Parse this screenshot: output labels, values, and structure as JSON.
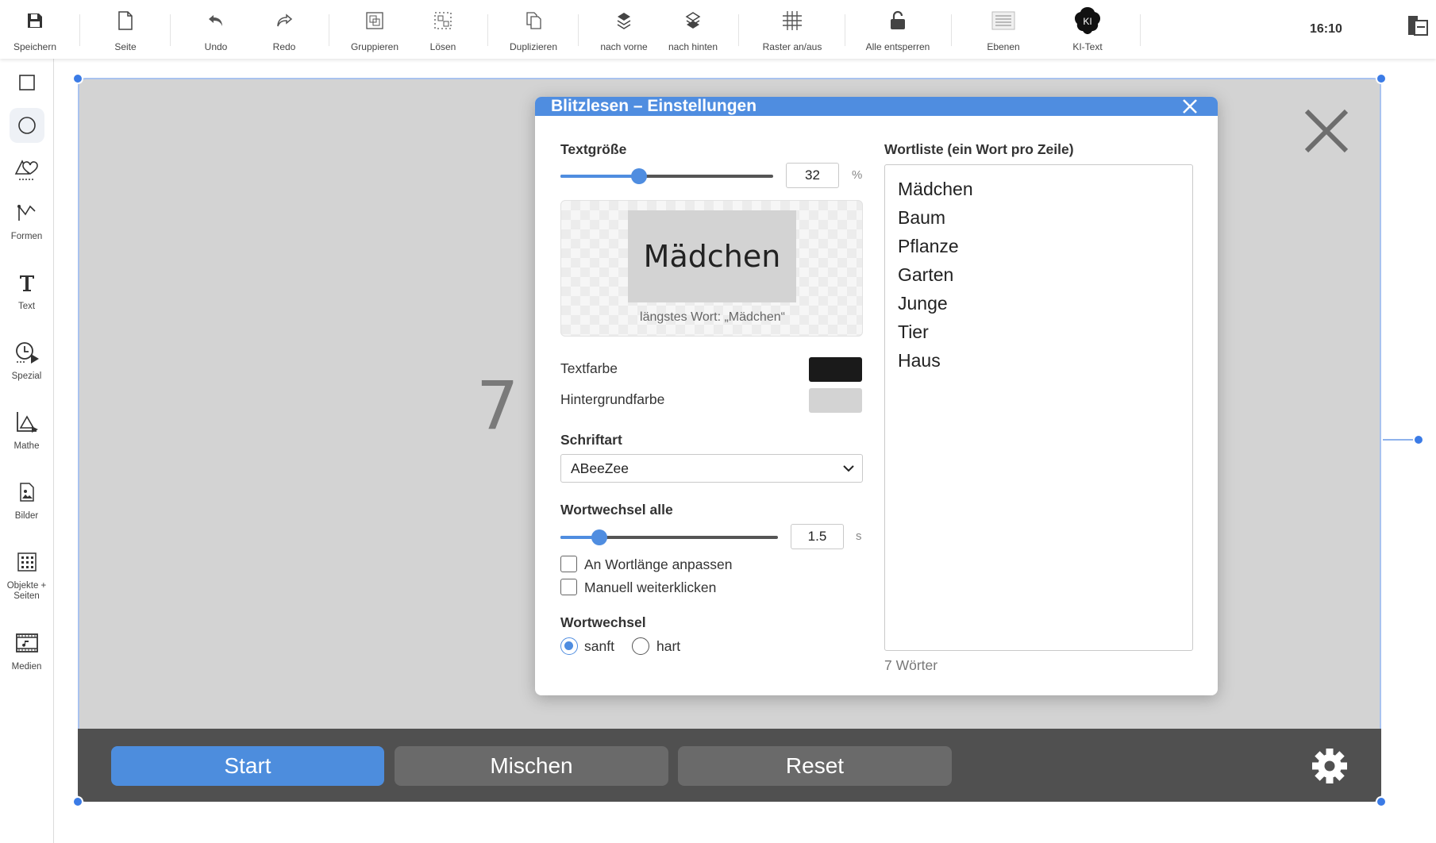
{
  "toolbar": {
    "items": [
      {
        "label": "Speichern",
        "icon": "floppy-disk-icon"
      },
      {
        "label": "Seite",
        "icon": "page-icon"
      },
      {
        "label": "Undo",
        "icon": "undo-icon"
      },
      {
        "label": "Redo",
        "icon": "redo-icon"
      },
      {
        "label": "Gruppieren",
        "icon": "group-icon"
      },
      {
        "label": "Lösen",
        "icon": "ungroup-icon"
      },
      {
        "label": "Duplizieren",
        "icon": "duplicate-icon"
      },
      {
        "label": "nach vorne",
        "icon": "bring-forward-icon"
      },
      {
        "label": "nach hinten",
        "icon": "send-backward-icon"
      },
      {
        "label": "Raster an/aus",
        "icon": "grid-icon"
      },
      {
        "label": "Alle entsperren",
        "icon": "unlock-icon"
      },
      {
        "label": "Ebenen",
        "icon": "layers-icon"
      },
      {
        "label": "KI-Text",
        "icon": "ai-brain-icon"
      }
    ],
    "ai_badge": "KI",
    "clock": "16:10"
  },
  "sidebar": {
    "items": [
      {
        "label": "",
        "icon": "rectangle-icon"
      },
      {
        "label": "",
        "icon": "circle-icon"
      },
      {
        "label": "",
        "icon": "shapes-icon"
      },
      {
        "label": "Formen",
        "icon": "polyline-icon"
      },
      {
        "label": "Text",
        "icon": "text-icon"
      },
      {
        "label": "Spezial",
        "icon": "timer-icon"
      },
      {
        "label": "Mathe",
        "icon": "geometry-icon"
      },
      {
        "label": "Bilder",
        "icon": "image-icon"
      },
      {
        "label": "Objekte + Seiten",
        "icon": "grid-objects-icon"
      },
      {
        "label": "Medien",
        "icon": "media-icon"
      }
    ]
  },
  "widget": {
    "countdown": "7",
    "buttons": {
      "start": "Start",
      "mix": "Mischen",
      "reset": "Reset"
    }
  },
  "dialog": {
    "title": "Blitzlesen – Einstellungen",
    "text_size": {
      "label": "Textgröße",
      "value": "32",
      "unit": "%",
      "slider_fraction": 0.37
    },
    "preview": {
      "word": "Mädchen",
      "caption": "längstes Wort: „Mädchen“"
    },
    "text_color": {
      "label": "Textfarbe",
      "color": "#1a1a1a"
    },
    "bg_color": {
      "label": "Hintergrundfarbe",
      "color": "#d3d3d3"
    },
    "font": {
      "label": "Schriftart",
      "value": "ABeeZee"
    },
    "interval": {
      "label": "Wortwechsel alle",
      "value": "1.5",
      "unit": "s",
      "slider_fraction": 0.18
    },
    "options": {
      "adapt_length": {
        "label": "An Wortlänge anpassen",
        "checked": false
      },
      "manual": {
        "label": "Manuell weiterklicken",
        "checked": false
      }
    },
    "transition": {
      "label": "Wortwechsel",
      "options": [
        "sanft",
        "hart"
      ],
      "selected": "sanft"
    },
    "wordlist": {
      "label": "Wortliste (ein Wort pro Zeile)",
      "words": [
        "Mädchen",
        "Baum",
        "Pflanze",
        "Garten",
        "Junge",
        "Tier",
        "Haus"
      ],
      "count_text": "7 Wörter"
    }
  },
  "colors": {
    "accent": "#4f8de0",
    "bar": "#505050",
    "canvas": "#d3d3d3"
  }
}
